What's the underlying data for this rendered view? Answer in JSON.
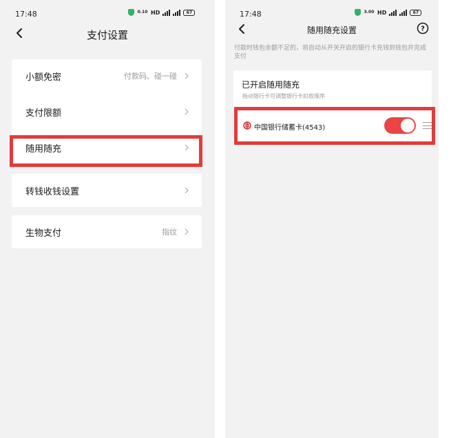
{
  "left_screen": {
    "status": {
      "time": "17:48",
      "speed": "0.10",
      "network": "HD",
      "battery": "67"
    },
    "nav": {
      "title": "支付设置"
    },
    "groups": [
      {
        "label": "小额免密",
        "value": "付款码、碰一碰"
      },
      {
        "label": "支付限额",
        "value": ""
      },
      {
        "label": "随用随充",
        "value": ""
      },
      {
        "label": "转钱收钱设置",
        "value": ""
      },
      {
        "label": "生物支付",
        "value": "指纹"
      }
    ]
  },
  "right_screen": {
    "status": {
      "time": "17:48",
      "speed": "3.00",
      "network": "HD",
      "battery": "67"
    },
    "nav": {
      "title": "随用随充设置"
    },
    "tip": "付款时钱包余额不足的，将自动从开关开启的银行卡充钱到钱包并完成支付",
    "section_title": "已开启随用随充",
    "section_subtitle": "拖动银行卡可调整银行卡扣款顺序",
    "bank_card": {
      "label": "中国银行储蓄卡(4543)",
      "enabled": true
    }
  },
  "colors": {
    "accent": "#ea4444",
    "highlight": "#e33b3b",
    "background": "#f2f2f2",
    "card": "#ffffff",
    "muted": "#9a9a9a"
  },
  "icons": [
    "back-arrow-icon",
    "chevron-right-icon",
    "help-icon",
    "bank-of-china-icon",
    "drag-handle-icon",
    "shield-icon",
    "signal-icon",
    "battery-icon"
  ]
}
